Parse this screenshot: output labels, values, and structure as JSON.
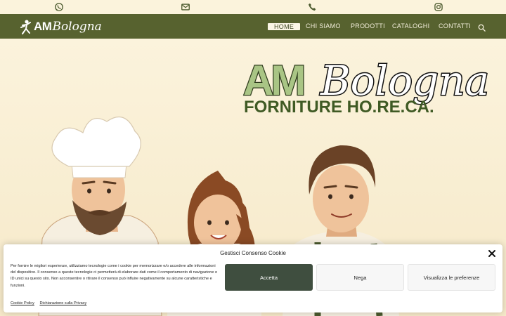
{
  "topbar": {
    "icons": [
      "whatsapp-icon",
      "mail-icon",
      "phone-icon",
      "instagram-icon"
    ],
    "color": "#4b5a2e"
  },
  "nav": {
    "logo_am": "AM",
    "logo_bologna": "Bologna",
    "items": [
      {
        "label": "HOME",
        "active": true
      },
      {
        "label": "CHI SIAMO",
        "active": false
      },
      {
        "label": "PRODOTTI",
        "active": false
      },
      {
        "label": "CATALOGHI",
        "active": false
      },
      {
        "label": "CONTATTI",
        "active": false
      }
    ],
    "search_icon": "search-icon",
    "background": "#57622f"
  },
  "hero": {
    "brand_am": "AM",
    "brand_bologna": "Bologna",
    "brand_sub": "FORNITURE HO.RE.CA.",
    "brand_green": "#a9c585",
    "brand_dark": "#2d3a1c",
    "sub_color": "#3f5a24"
  },
  "cookie": {
    "title": "Gestisci Consenso Cookie",
    "text": "Per fornire le migliori esperienze, utilizziamo tecnologie come i cookie per memorizzare e/o accedere alle informazioni del dispositivo. Il consenso a queste tecnologie ci permetterà di elaborare dati come il comportamento di navigazione o ID unici su questo sito. Non acconsentire o ritirare il consenso può influire negativamente su alcune caratteristiche e funzioni.",
    "accept_label": "Accetta",
    "deny_label": "Nega",
    "prefs_label": "Visualizza le preferenze",
    "cookie_policy_label": "Cookie Policy",
    "privacy_label": "Dichiarazione sulla Privacy",
    "accept_color": "#3f4e3f"
  }
}
